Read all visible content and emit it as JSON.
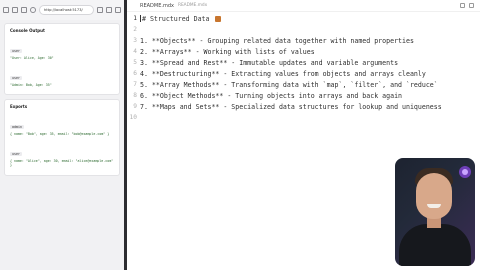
{
  "browser": {
    "url": "http://localhost:5173/",
    "console_card": {
      "title": "Console Output",
      "entries": [
        {
          "tag": "user",
          "value": "\"User: Alice, Age: 30\""
        },
        {
          "tag": "user",
          "value": "\"Admin: Bob, Age: 35\""
        }
      ]
    },
    "exports_card": {
      "title": "Exports",
      "entries": [
        {
          "tag": "admin",
          "value": "{ name: \"Bob\", age: 35, email: \"bob@example.com\" }"
        },
        {
          "tag": "user",
          "value": "{ name: \"Alice\", age: 30, email: \"alice@example.com\" }"
        }
      ]
    }
  },
  "editor": {
    "tab_label": "README.mdx",
    "tab_description": "README.mdx",
    "lines": [
      {
        "number": "1",
        "text": "# Structured Data "
      },
      {
        "number": "2",
        "text": ""
      },
      {
        "number": "3",
        "text": "1. **Objects** - Grouping related data together with named properties"
      },
      {
        "number": "4",
        "text": "2. **Arrays** - Working with lists of values"
      },
      {
        "number": "5",
        "text": "3. **Spread and Rest** - Immutable updates and variable arguments"
      },
      {
        "number": "6",
        "text": "4. **Destructuring** - Extracting values from objects and arrays cleanly"
      },
      {
        "number": "7",
        "text": "5. **Array Methods** - Transforming data with `map`, `filter`, and `reduce`"
      },
      {
        "number": "8",
        "text": "6. **Object Methods** - Turning objects into arrays and back again"
      },
      {
        "number": "9",
        "text": "7. **Maps and Sets** - Specialized data structures for lookup and uniqueness"
      },
      {
        "number": "10",
        "text": ""
      }
    ]
  }
}
